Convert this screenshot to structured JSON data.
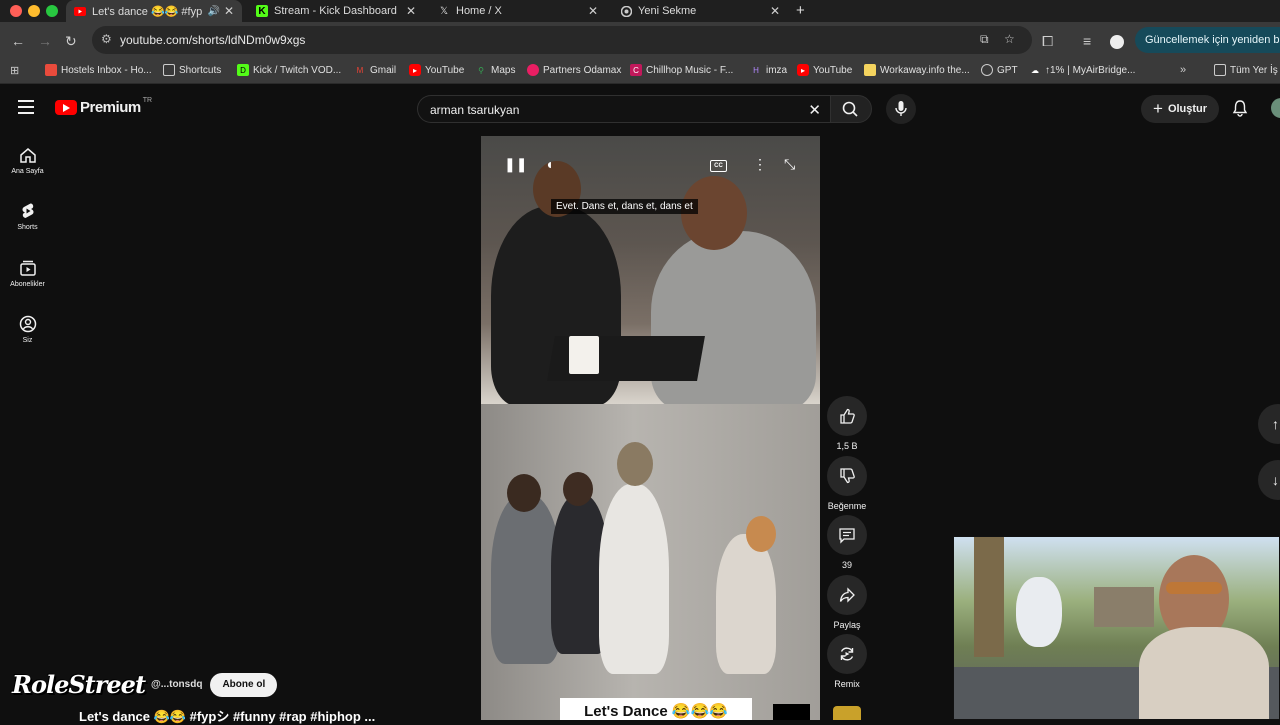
{
  "browser": {
    "tabs": [
      {
        "title": "Let's dance 😂😂 #fyp:",
        "active": true
      },
      {
        "title": "Stream - Kick Dashboard",
        "active": false
      },
      {
        "title": "Home / X",
        "active": false
      },
      {
        "title": "Yeni Sekme",
        "active": false
      }
    ],
    "url": "youtube.com/shorts/ldNDm0w9xgs",
    "update_button": "Güncellemek için yeniden baş",
    "bookmarks": [
      "Hostels Inbox - Ho...",
      "Shortcuts",
      "Kick / Twitch VOD...",
      "Gmail",
      "YouTube",
      "Maps",
      "Partners Odamax",
      "Chillhop Music - F...",
      "imza",
      "YouTube",
      "Workaway.info the...",
      "GPT",
      "↑1% | MyAirBridge...",
      "Tüm Yer İş"
    ]
  },
  "youtube": {
    "logo_word": "Premium",
    "logo_region": "TR",
    "search_query": "arman tsarukyan",
    "create_label": "Oluştur",
    "guide": [
      {
        "label": "Ana Sayfa",
        "icon": "home-icon"
      },
      {
        "label": "Shorts",
        "icon": "shorts-icon"
      },
      {
        "label": "Abonelikler",
        "icon": "subscriptions-icon"
      },
      {
        "label": "Siz",
        "icon": "you-icon"
      }
    ]
  },
  "short": {
    "caption": "Evet.  Dans et, dans et, dans et",
    "overlay_text": "Let's Dance 😂😂😂",
    "channel_name": "@...tonsdq",
    "subscribe_label": "Abone ol",
    "title": "Let's dance 😂😂 #fypシ #funny #rap #hiphop ...",
    "watermark": "RoleStreet",
    "actions": {
      "like_count": "1,5 B",
      "dislike_label": "Beğenme",
      "comment_count": "39",
      "share_label": "Paylaş",
      "remix_label": "Remix"
    }
  },
  "colors": {
    "youtube_red": "#ff0000",
    "bg": "#0f0f0f",
    "update_btn": "#164a5a"
  }
}
